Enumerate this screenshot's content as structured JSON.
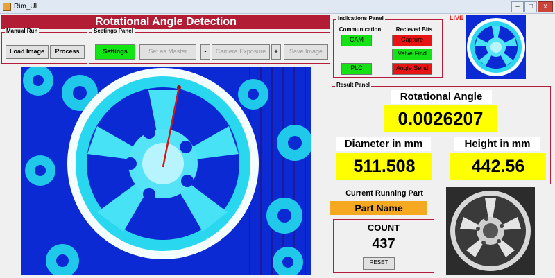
{
  "window": {
    "title": "Rim_UI",
    "btn_min": "–",
    "btn_max": "□",
    "btn_close": "x"
  },
  "header": {
    "title": "Rotational Angle Detection"
  },
  "manual_run": {
    "title": "Manual Run",
    "load_label": "Load Image",
    "process_label": "Process"
  },
  "settings_panel": {
    "title": "Seetings Panel",
    "settings_label": "Settings",
    "set_master_label": "Set as Master",
    "minus_label": "-",
    "exposure_label": "Camera Exposure",
    "plus_label": "+",
    "save_label": "Save Image"
  },
  "indications": {
    "title": "Indications Panel",
    "comm_header": "Communication",
    "bits_header": "Recieved Bits",
    "cam": "CAM",
    "plc": "PLC",
    "capture": "Capture",
    "valve_find": "Valve Find",
    "angle_send": "Angle Send"
  },
  "live": {
    "label": "LIVE"
  },
  "result": {
    "title": "Result Panel",
    "angle_label": "Rotational Angle",
    "angle_value": "0.0026207",
    "diameter_label": "Diameter in mm",
    "diameter_value": "511.508",
    "height_label": "Height in mm",
    "height_value": "442.56"
  },
  "part": {
    "label": "Current Running Part",
    "name": "Part Name"
  },
  "count": {
    "label": "COUNT",
    "value": "437",
    "reset_label": "RESET"
  },
  "colors": {
    "accent": "#b21c34",
    "yellow": "#ffff00",
    "green": "#14e214",
    "red": "#e81414",
    "part_bg": "#f5a921"
  },
  "icons": [
    "app-icon",
    "minimize-icon",
    "maximize-icon",
    "close-icon"
  ],
  "images": [
    "processed-wheel-image",
    "live-camera-image",
    "running-part-image"
  ]
}
